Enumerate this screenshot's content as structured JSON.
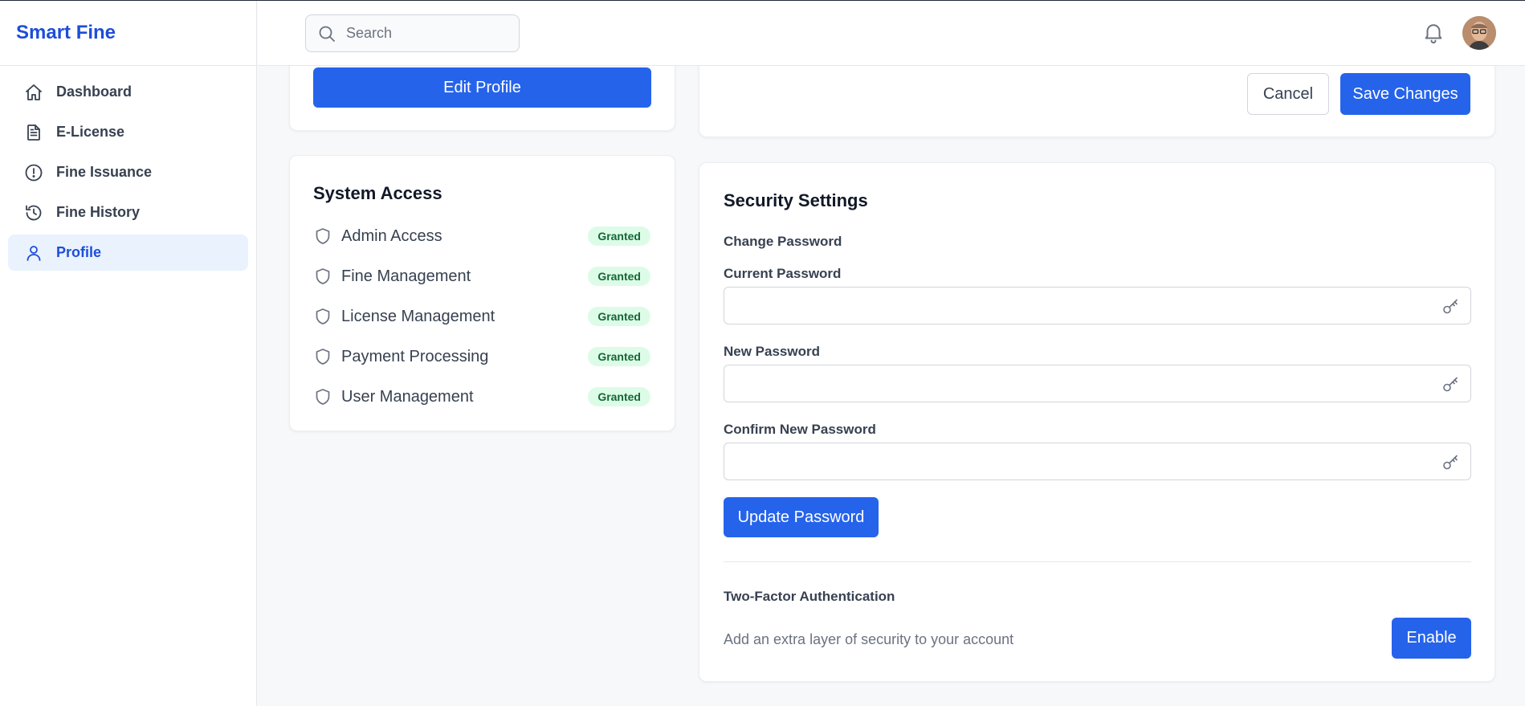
{
  "app": {
    "name": "Smart Fine"
  },
  "sidebar": {
    "items": [
      {
        "label": "Dashboard",
        "icon": "home-icon",
        "active": false
      },
      {
        "label": "E-License",
        "icon": "document-icon",
        "active": false
      },
      {
        "label": "Fine Issuance",
        "icon": "alert-circle-icon",
        "active": false
      },
      {
        "label": "Fine History",
        "icon": "history-icon",
        "active": false
      },
      {
        "label": "Profile",
        "icon": "user-icon",
        "active": true
      }
    ]
  },
  "topbar": {
    "search_placeholder": "Search",
    "icons": [
      "search-icon",
      "bell-icon",
      "avatar"
    ]
  },
  "profile_card": {
    "edit_button": "Edit Profile"
  },
  "actions": {
    "cancel": "Cancel",
    "save": "Save Changes"
  },
  "system_access": {
    "title": "System Access",
    "items": [
      {
        "label": "Admin Access",
        "status": "Granted"
      },
      {
        "label": "Fine Management",
        "status": "Granted"
      },
      {
        "label": "License Management",
        "status": "Granted"
      },
      {
        "label": "Payment Processing",
        "status": "Granted"
      },
      {
        "label": "User Management",
        "status": "Granted"
      }
    ]
  },
  "security": {
    "title": "Security Settings",
    "change_password": "Change Password",
    "current_password_label": "Current Password",
    "current_password_value": "",
    "new_password_label": "New Password",
    "new_password_value": "",
    "confirm_password_label": "Confirm New Password",
    "confirm_password_value": "",
    "update_button": "Update Password",
    "two_factor_title": "Two-Factor Authentication",
    "two_factor_desc": "Add an extra layer of security to your account",
    "enable_button": "Enable"
  },
  "colors": {
    "accent": "#2563eb",
    "brand_text": "#1d4ed8",
    "active_nav_bg": "#eaf2fe",
    "granted_bg": "#dcfce7",
    "granted_text": "#166534"
  }
}
